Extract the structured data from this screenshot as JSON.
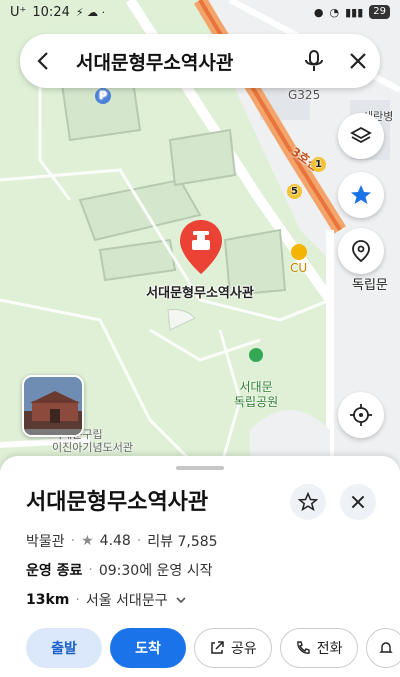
{
  "status": {
    "carrier": "U⁺",
    "time": "10:24",
    "battery": "29"
  },
  "search": {
    "query": "서대문형무소역사관"
  },
  "map": {
    "pin_label": "서대문형무소역사관",
    "park_label": "서대문\n독립공원",
    "store_label": "CU",
    "station_label": "독립문",
    "station_label2": "독립문",
    "hospital_label": "세란병원",
    "road_label": "3호선",
    "other_label": "G325",
    "corner_text": "서대문구립\n이진아기념도서관",
    "route_badges": [
      "1",
      "5"
    ]
  },
  "sheet": {
    "title": "서대문형무소역사관",
    "category": "박물관",
    "rating": "4.48",
    "reviews": "리뷰 7,585",
    "status_label": "운영 종료",
    "status_detail": "09:30에 운영 시작",
    "distance": "13km",
    "address": "서울 서대문구",
    "actions": {
      "depart": "출발",
      "arrive": "도착",
      "share": "공유",
      "call": "전화"
    }
  },
  "colors": {
    "accent": "#1a73e8",
    "pin": "#ea4335",
    "star": "#1a73e8"
  }
}
